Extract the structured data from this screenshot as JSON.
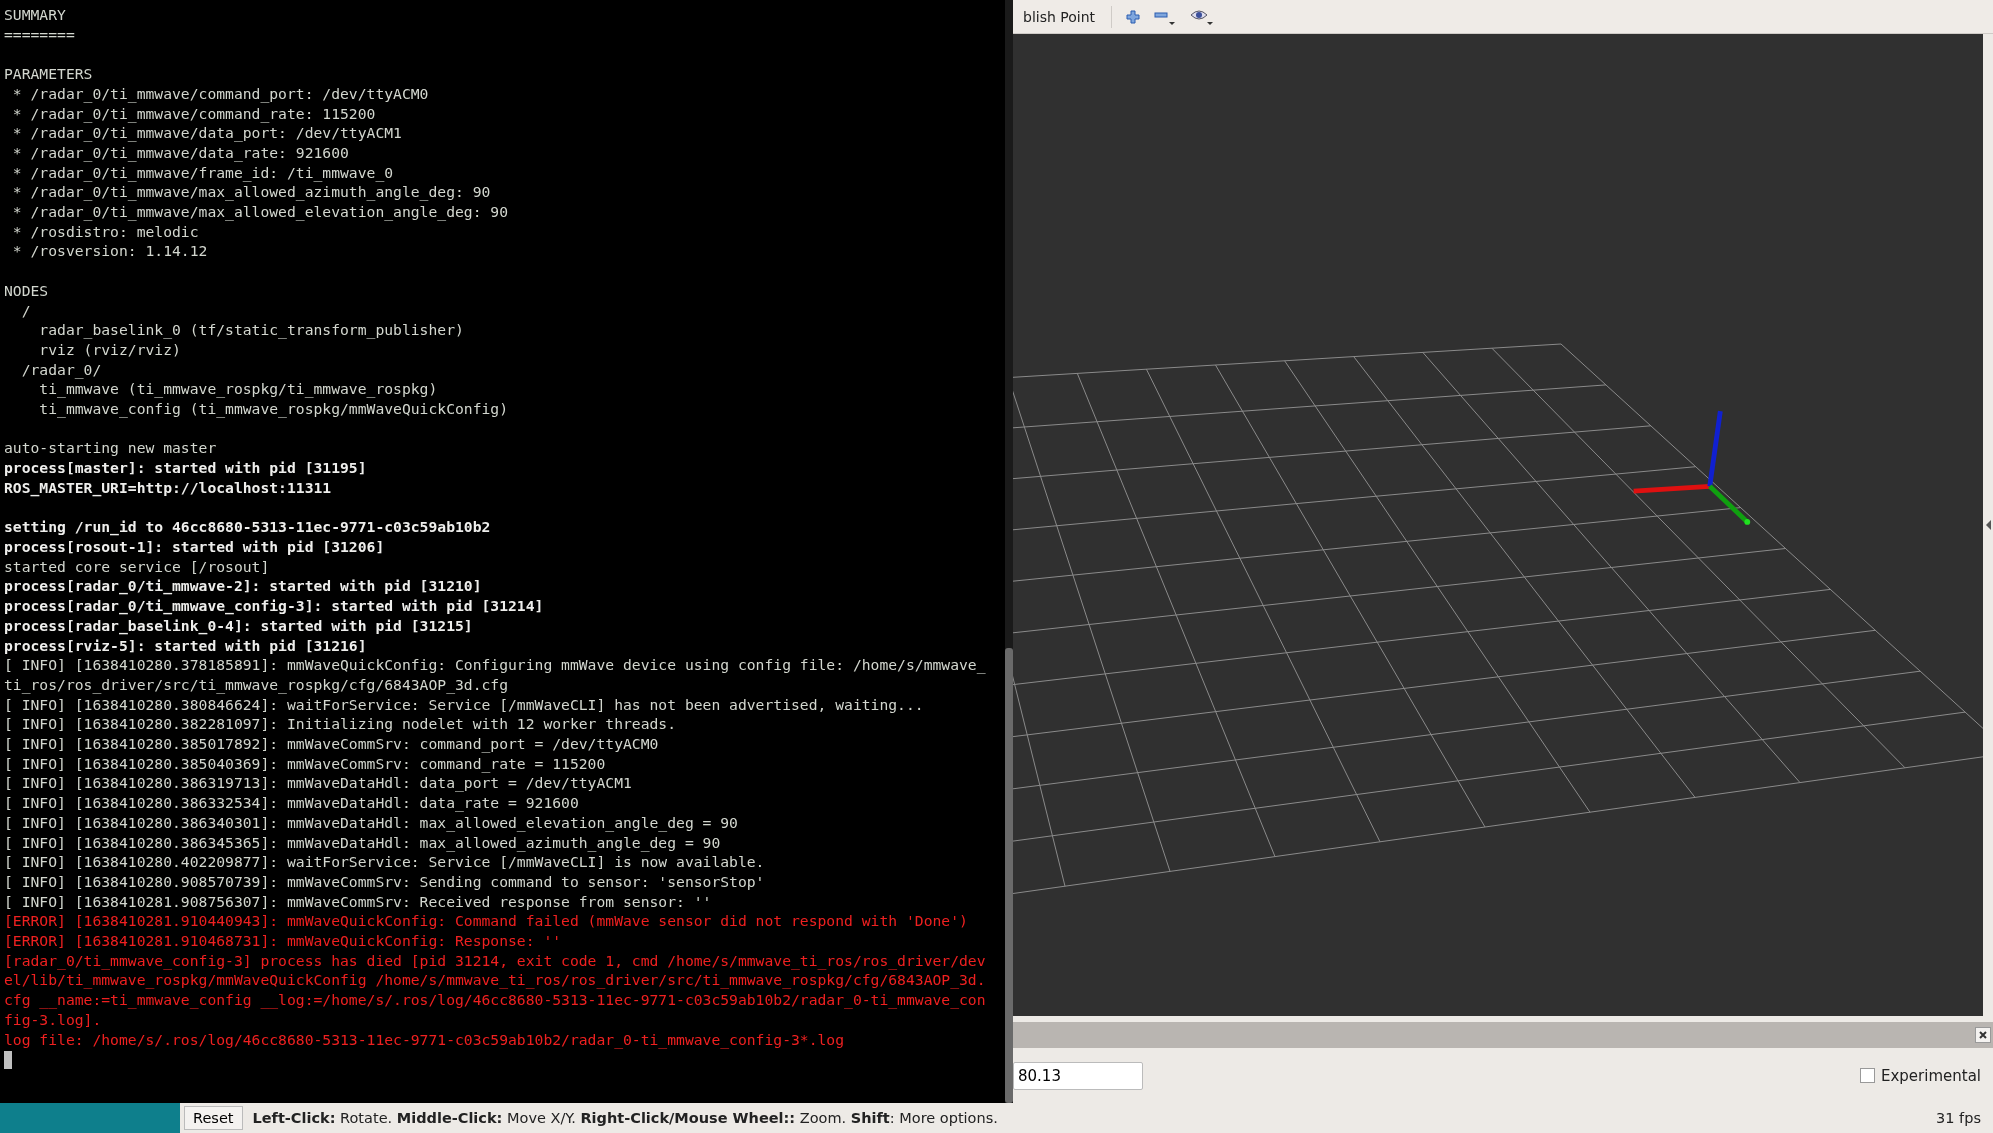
{
  "terminal": {
    "lines": [
      {
        "kind": "normal",
        "text": "SUMMARY"
      },
      {
        "kind": "normal",
        "text": "========"
      },
      {
        "kind": "blank"
      },
      {
        "kind": "normal",
        "text": "PARAMETERS"
      },
      {
        "kind": "normal",
        "text": " * /radar_0/ti_mmwave/command_port: /dev/ttyACM0"
      },
      {
        "kind": "normal",
        "text": " * /radar_0/ti_mmwave/command_rate: 115200"
      },
      {
        "kind": "normal",
        "text": " * /radar_0/ti_mmwave/data_port: /dev/ttyACM1"
      },
      {
        "kind": "normal",
        "text": " * /radar_0/ti_mmwave/data_rate: 921600"
      },
      {
        "kind": "normal",
        "text": " * /radar_0/ti_mmwave/frame_id: /ti_mmwave_0"
      },
      {
        "kind": "normal",
        "text": " * /radar_0/ti_mmwave/max_allowed_azimuth_angle_deg: 90"
      },
      {
        "kind": "normal",
        "text": " * /radar_0/ti_mmwave/max_allowed_elevation_angle_deg: 90"
      },
      {
        "kind": "normal",
        "text": " * /rosdistro: melodic"
      },
      {
        "kind": "normal",
        "text": " * /rosversion: 1.14.12"
      },
      {
        "kind": "blank"
      },
      {
        "kind": "normal",
        "text": "NODES"
      },
      {
        "kind": "normal",
        "text": "  /"
      },
      {
        "kind": "normal",
        "text": "    radar_baselink_0 (tf/static_transform_publisher)"
      },
      {
        "kind": "normal",
        "text": "    rviz (rviz/rviz)"
      },
      {
        "kind": "normal",
        "text": "  /radar_0/"
      },
      {
        "kind": "normal",
        "text": "    ti_mmwave (ti_mmwave_rospkg/ti_mmwave_rospkg)"
      },
      {
        "kind": "normal",
        "text": "    ti_mmwave_config (ti_mmwave_rospkg/mmWaveQuickConfig)"
      },
      {
        "kind": "blank"
      },
      {
        "kind": "normal",
        "text": "auto-starting new master"
      },
      {
        "kind": "bold",
        "text": "process[master]: started with pid [31195]"
      },
      {
        "kind": "bold",
        "text": "ROS_MASTER_URI=http://localhost:11311"
      },
      {
        "kind": "blank"
      },
      {
        "kind": "bold",
        "text": "setting /run_id to 46cc8680-5313-11ec-9771-c03c59ab10b2"
      },
      {
        "kind": "bold",
        "text": "process[rosout-1]: started with pid [31206]"
      },
      {
        "kind": "normal",
        "text": "started core service [/rosout]"
      },
      {
        "kind": "bold",
        "text": "process[radar_0/ti_mmwave-2]: started with pid [31210]"
      },
      {
        "kind": "bold",
        "text": "process[radar_0/ti_mmwave_config-3]: started with pid [31214]"
      },
      {
        "kind": "bold",
        "text": "process[radar_baselink_0-4]: started with pid [31215]"
      },
      {
        "kind": "bold",
        "text": "process[rviz-5]: started with pid [31216]"
      },
      {
        "kind": "normal",
        "text": "[ INFO] [1638410280.378185891]: mmWaveQuickConfig: Configuring mmWave device using config file: /home/s/mmwave_"
      },
      {
        "kind": "normal",
        "text": "ti_ros/ros_driver/src/ti_mmwave_rospkg/cfg/6843AOP_3d.cfg"
      },
      {
        "kind": "normal",
        "text": "[ INFO] [1638410280.380846624]: waitForService: Service [/mmWaveCLI] has not been advertised, waiting..."
      },
      {
        "kind": "normal",
        "text": "[ INFO] [1638410280.382281097]: Initializing nodelet with 12 worker threads."
      },
      {
        "kind": "normal",
        "text": "[ INFO] [1638410280.385017892]: mmWaveCommSrv: command_port = /dev/ttyACM0"
      },
      {
        "kind": "normal",
        "text": "[ INFO] [1638410280.385040369]: mmWaveCommSrv: command_rate = 115200"
      },
      {
        "kind": "normal",
        "text": "[ INFO] [1638410280.386319713]: mmWaveDataHdl: data_port = /dev/ttyACM1"
      },
      {
        "kind": "normal",
        "text": "[ INFO] [1638410280.386332534]: mmWaveDataHdl: data_rate = 921600"
      },
      {
        "kind": "normal",
        "text": "[ INFO] [1638410280.386340301]: mmWaveDataHdl: max_allowed_elevation_angle_deg = 90"
      },
      {
        "kind": "normal",
        "text": "[ INFO] [1638410280.386345365]: mmWaveDataHdl: max_allowed_azimuth_angle_deg = 90"
      },
      {
        "kind": "normal",
        "text": "[ INFO] [1638410280.402209877]: waitForService: Service [/mmWaveCLI] is now available."
      },
      {
        "kind": "normal",
        "text": "[ INFO] [1638410280.908570739]: mmWaveCommSrv: Sending command to sensor: 'sensorStop'"
      },
      {
        "kind": "normal",
        "text": "[ INFO] [1638410281.908756307]: mmWaveCommSrv: Received response from sensor: ''"
      },
      {
        "kind": "error",
        "text": "[ERROR] [1638410281.910440943]: mmWaveQuickConfig: Command failed (mmWave sensor did not respond with 'Done')"
      },
      {
        "kind": "error",
        "text": "[ERROR] [1638410281.910468731]: mmWaveQuickConfig: Response: ''"
      },
      {
        "kind": "error",
        "text": "[radar_0/ti_mmwave_config-3] process has died [pid 31214, exit code 1, cmd /home/s/mmwave_ti_ros/ros_driver/dev"
      },
      {
        "kind": "error",
        "text": "el/lib/ti_mmwave_rospkg/mmWaveQuickConfig /home/s/mmwave_ti_ros/ros_driver/src/ti_mmwave_rospkg/cfg/6843AOP_3d."
      },
      {
        "kind": "error",
        "text": "cfg __name:=ti_mmwave_config __log:=/home/s/.ros/log/46cc8680-5313-11ec-9771-c03c59ab10b2/radar_0-ti_mmwave_con"
      },
      {
        "kind": "error",
        "text": "fig-3.log]."
      },
      {
        "kind": "error",
        "text": "log file: /home/s/.ros/log/46cc8680-5313-11ec-9771-c03c59ab10b2/radar_0-ti_mmwave_config-3*.log"
      }
    ]
  },
  "rviz": {
    "toolbar": {
      "tool_label": "blish Point"
    },
    "time_panel": {
      "field_value": "80.13",
      "experimental": {
        "label": "Experimental",
        "checked": false
      }
    }
  },
  "status_bar": {
    "reset_button": "Reset",
    "help": "**Left-Click:** Rotate. **Middle-Click:** Move X/Y. **Right-Click/Mouse Wheel::** Zoom. **Shift**: More options.",
    "fps": "31 fps"
  }
}
